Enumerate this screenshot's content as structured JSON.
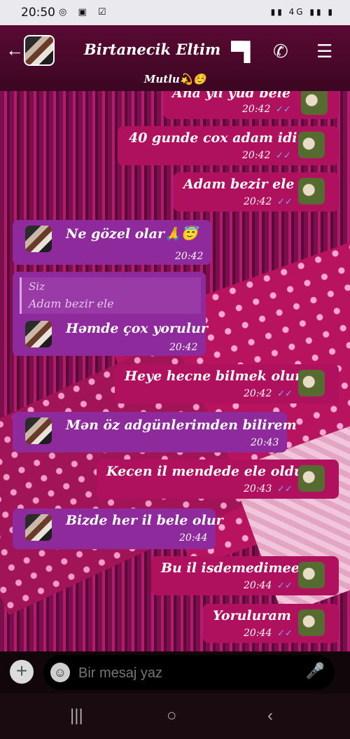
{
  "status_bar": {
    "time": "20:50",
    "left_icons": "◎ ▣ ☑",
    "right_icons": "▮▮ 4G ▮▮ ▮"
  },
  "header": {
    "back_icon": "←",
    "contact_name": "Birtanecik Eltim",
    "video_icon": "▀▌",
    "call_icon": "✆",
    "menu_icon": "☰",
    "status": "Mutlu💫☺️"
  },
  "messages": [
    {
      "dir": "out",
      "text": "Ana yli yud bele",
      "time": "20:42"
    },
    {
      "dir": "out",
      "text": "40 gunde cox adam idi",
      "time": "20:42"
    },
    {
      "dir": "out",
      "text": "Adam bezir ele",
      "time": "20:42"
    },
    {
      "dir": "in",
      "text": "Ne gözel olar🙏😇",
      "time": "20:42"
    },
    {
      "dir": "in",
      "reply_sender": "Siz",
      "reply_text": "Adam bezir ele",
      "text": "Həmde çox yorulur",
      "time": "20:42"
    },
    {
      "dir": "out",
      "text": "Heye hecne bilmek olur",
      "time": "20:42"
    },
    {
      "dir": "in",
      "text": "Mən öz adgünlerimden bilirem",
      "time": "20:43"
    },
    {
      "dir": "out",
      "text": "Kecen il mendede ele oldu",
      "time": "20:43"
    },
    {
      "dir": "in",
      "text": "Bizde her il bele olur",
      "time": "20:44"
    },
    {
      "dir": "out",
      "text": "Bu il isdemedimee",
      "time": "20:44"
    },
    {
      "dir": "out",
      "text": "Yoruluram",
      "time": "20:44"
    }
  ],
  "ticks": "✓✓",
  "composer": {
    "placeholder": "Bir mesaj yaz",
    "plus_icon": "+",
    "emoji_icon": "☺",
    "mic_icon": "🎤"
  },
  "navbar": {
    "recents_icon": "|||",
    "home_icon": "○",
    "back_icon": "‹"
  }
}
